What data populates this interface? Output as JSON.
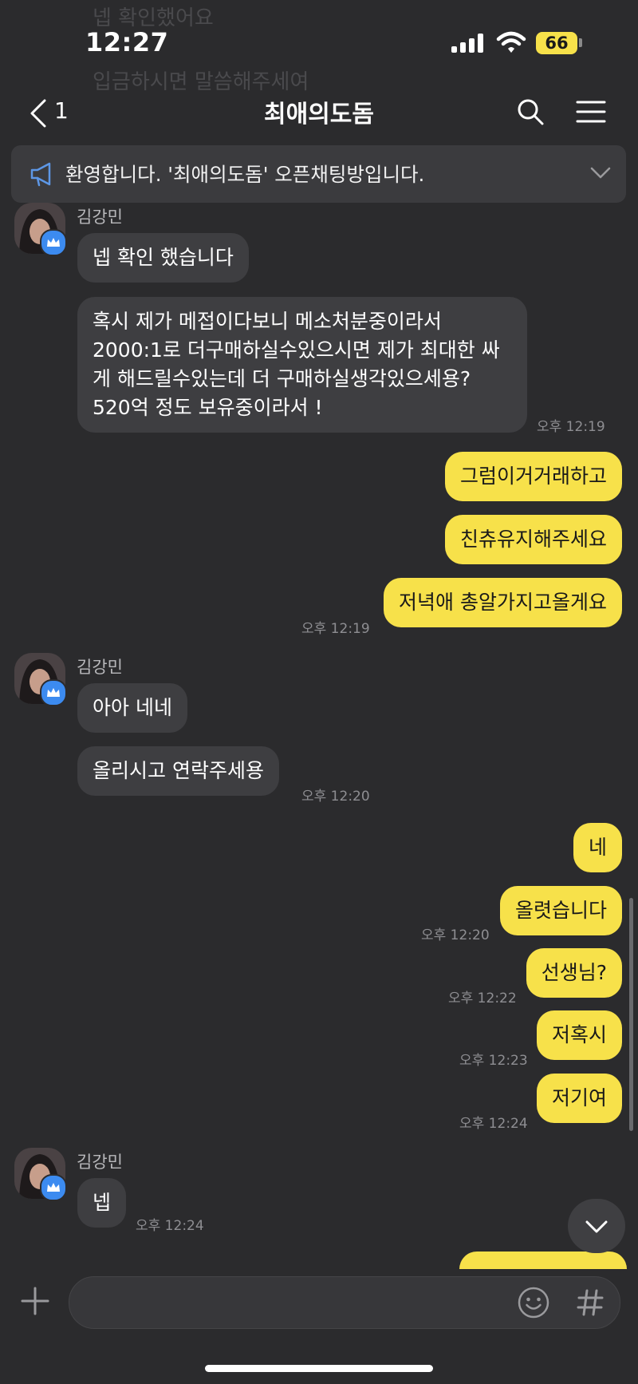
{
  "ghost": {
    "line1": "넵 확인했어요",
    "line2": "입금하시면 말씀해주세여"
  },
  "status_bar": {
    "time": "12:27",
    "battery": "66"
  },
  "header": {
    "back_count": "1",
    "title": "최애의도돔"
  },
  "notice": {
    "text": "환영합니다. '최애의도돔' 오픈채팅방입니다."
  },
  "messages": {
    "g1": {
      "sender": "김강민",
      "m1": "넵 확인 했습니다",
      "m2": "혹시 제가 메접이다보니 메소처분중이라서 2000:1로 더구매하실수있으시면 제가 최대한 싸게 해드릴수있는데 더 구매하실생각있으세용? 520억 정도 보유중이라서 !",
      "time": "오후 12:19"
    },
    "o1": {
      "m1": "그럼이거거래하고",
      "m2": "친츄유지해주세요",
      "m3": "저녁애 총알가지고올게요",
      "time": "오후 12:19"
    },
    "g2": {
      "sender": "김강민",
      "m1": "아아 네네",
      "m2": "올리시고 연락주세용",
      "time": "오후 12:20"
    },
    "o2": {
      "m1": "네",
      "m2": "올렷습니다",
      "t2": "오후 12:20",
      "m3": "선생님?",
      "t3": "오후 12:22",
      "m4": "저혹시",
      "t4": "오후 12:23",
      "m5": "저기여",
      "t5": "오후 12:24"
    },
    "g3": {
      "sender": "김강민",
      "m1": "넵",
      "time": "오후 12:24"
    }
  },
  "icons": {
    "back": "chevron-left-icon",
    "search": "search-icon",
    "menu": "menu-icon",
    "notice": "megaphone-icon",
    "expand": "chevron-down-icon",
    "scroll": "chevron-down-icon",
    "add": "plus-icon",
    "emoji": "emoji-icon",
    "hashtag": "hashtag-icon"
  },
  "colors": {
    "background": "#2b2b2d",
    "incoming": "#3e3e41",
    "outgoing": "#f7e14a",
    "badge": "#3c8bf0"
  }
}
